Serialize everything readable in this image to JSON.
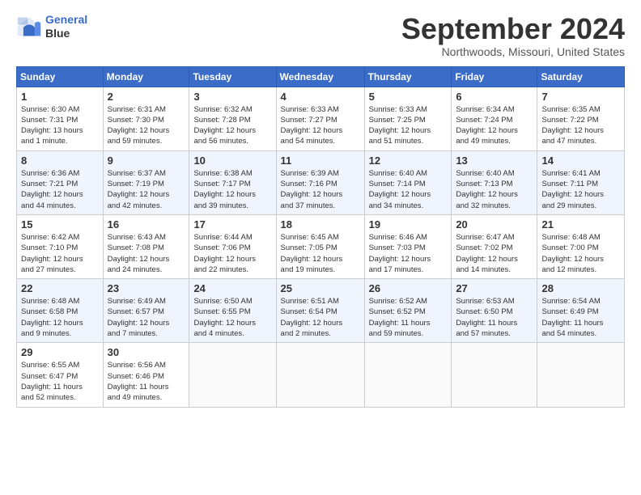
{
  "header": {
    "logo_line1": "General",
    "logo_line2": "Blue",
    "month_year": "September 2024",
    "location": "Northwoods, Missouri, United States"
  },
  "weekdays": [
    "Sunday",
    "Monday",
    "Tuesday",
    "Wednesday",
    "Thursday",
    "Friday",
    "Saturday"
  ],
  "weeks": [
    [
      {
        "day": "1",
        "info": "Sunrise: 6:30 AM\nSunset: 7:31 PM\nDaylight: 13 hours\nand 1 minute."
      },
      {
        "day": "2",
        "info": "Sunrise: 6:31 AM\nSunset: 7:30 PM\nDaylight: 12 hours\nand 59 minutes."
      },
      {
        "day": "3",
        "info": "Sunrise: 6:32 AM\nSunset: 7:28 PM\nDaylight: 12 hours\nand 56 minutes."
      },
      {
        "day": "4",
        "info": "Sunrise: 6:33 AM\nSunset: 7:27 PM\nDaylight: 12 hours\nand 54 minutes."
      },
      {
        "day": "5",
        "info": "Sunrise: 6:33 AM\nSunset: 7:25 PM\nDaylight: 12 hours\nand 51 minutes."
      },
      {
        "day": "6",
        "info": "Sunrise: 6:34 AM\nSunset: 7:24 PM\nDaylight: 12 hours\nand 49 minutes."
      },
      {
        "day": "7",
        "info": "Sunrise: 6:35 AM\nSunset: 7:22 PM\nDaylight: 12 hours\nand 47 minutes."
      }
    ],
    [
      {
        "day": "8",
        "info": "Sunrise: 6:36 AM\nSunset: 7:21 PM\nDaylight: 12 hours\nand 44 minutes."
      },
      {
        "day": "9",
        "info": "Sunrise: 6:37 AM\nSunset: 7:19 PM\nDaylight: 12 hours\nand 42 minutes."
      },
      {
        "day": "10",
        "info": "Sunrise: 6:38 AM\nSunset: 7:17 PM\nDaylight: 12 hours\nand 39 minutes."
      },
      {
        "day": "11",
        "info": "Sunrise: 6:39 AM\nSunset: 7:16 PM\nDaylight: 12 hours\nand 37 minutes."
      },
      {
        "day": "12",
        "info": "Sunrise: 6:40 AM\nSunset: 7:14 PM\nDaylight: 12 hours\nand 34 minutes."
      },
      {
        "day": "13",
        "info": "Sunrise: 6:40 AM\nSunset: 7:13 PM\nDaylight: 12 hours\nand 32 minutes."
      },
      {
        "day": "14",
        "info": "Sunrise: 6:41 AM\nSunset: 7:11 PM\nDaylight: 12 hours\nand 29 minutes."
      }
    ],
    [
      {
        "day": "15",
        "info": "Sunrise: 6:42 AM\nSunset: 7:10 PM\nDaylight: 12 hours\nand 27 minutes."
      },
      {
        "day": "16",
        "info": "Sunrise: 6:43 AM\nSunset: 7:08 PM\nDaylight: 12 hours\nand 24 minutes."
      },
      {
        "day": "17",
        "info": "Sunrise: 6:44 AM\nSunset: 7:06 PM\nDaylight: 12 hours\nand 22 minutes."
      },
      {
        "day": "18",
        "info": "Sunrise: 6:45 AM\nSunset: 7:05 PM\nDaylight: 12 hours\nand 19 minutes."
      },
      {
        "day": "19",
        "info": "Sunrise: 6:46 AM\nSunset: 7:03 PM\nDaylight: 12 hours\nand 17 minutes."
      },
      {
        "day": "20",
        "info": "Sunrise: 6:47 AM\nSunset: 7:02 PM\nDaylight: 12 hours\nand 14 minutes."
      },
      {
        "day": "21",
        "info": "Sunrise: 6:48 AM\nSunset: 7:00 PM\nDaylight: 12 hours\nand 12 minutes."
      }
    ],
    [
      {
        "day": "22",
        "info": "Sunrise: 6:48 AM\nSunset: 6:58 PM\nDaylight: 12 hours\nand 9 minutes."
      },
      {
        "day": "23",
        "info": "Sunrise: 6:49 AM\nSunset: 6:57 PM\nDaylight: 12 hours\nand 7 minutes."
      },
      {
        "day": "24",
        "info": "Sunrise: 6:50 AM\nSunset: 6:55 PM\nDaylight: 12 hours\nand 4 minutes."
      },
      {
        "day": "25",
        "info": "Sunrise: 6:51 AM\nSunset: 6:54 PM\nDaylight: 12 hours\nand 2 minutes."
      },
      {
        "day": "26",
        "info": "Sunrise: 6:52 AM\nSunset: 6:52 PM\nDaylight: 11 hours\nand 59 minutes."
      },
      {
        "day": "27",
        "info": "Sunrise: 6:53 AM\nSunset: 6:50 PM\nDaylight: 11 hours\nand 57 minutes."
      },
      {
        "day": "28",
        "info": "Sunrise: 6:54 AM\nSunset: 6:49 PM\nDaylight: 11 hours\nand 54 minutes."
      }
    ],
    [
      {
        "day": "29",
        "info": "Sunrise: 6:55 AM\nSunset: 6:47 PM\nDaylight: 11 hours\nand 52 minutes."
      },
      {
        "day": "30",
        "info": "Sunrise: 6:56 AM\nSunset: 6:46 PM\nDaylight: 11 hours\nand 49 minutes."
      },
      {
        "day": "",
        "info": ""
      },
      {
        "day": "",
        "info": ""
      },
      {
        "day": "",
        "info": ""
      },
      {
        "day": "",
        "info": ""
      },
      {
        "day": "",
        "info": ""
      }
    ]
  ]
}
